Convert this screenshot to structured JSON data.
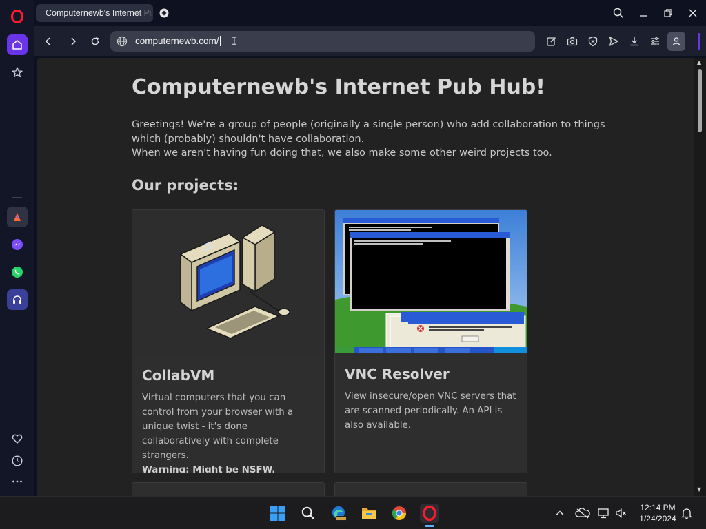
{
  "browser": {
    "tab_title": "Computernewb's Internet Pub Hub",
    "url": "computernewb.com/",
    "accent": "#6a35e8"
  },
  "sidebar": {
    "items": [
      {
        "name": "home",
        "icon": "home-icon"
      },
      {
        "name": "speed-dial",
        "icon": "star-icon"
      },
      {
        "name": "aria",
        "icon": "aria-icon"
      },
      {
        "name": "messenger",
        "icon": "messenger-icon"
      },
      {
        "name": "whatsapp",
        "icon": "whatsapp-icon"
      },
      {
        "name": "player",
        "icon": "music-player-icon"
      },
      {
        "name": "pinboards",
        "icon": "heart-icon"
      },
      {
        "name": "history",
        "icon": "clock-icon"
      },
      {
        "name": "more",
        "icon": "ellipsis-icon"
      }
    ]
  },
  "page": {
    "title": "Computernewb's Internet Pub Hub!",
    "intro_line1": "Greetings! We're a group of people (originally a single person) who add collaboration to things which (probably) shouldn't have collaboration.",
    "intro_line2": "When we aren't having fun doing that, we also make some other weird projects too.",
    "projects_heading": "Our projects:",
    "cards": [
      {
        "title": "CollabVM",
        "description": "Virtual computers that you can control from your browser with a unique twist - it's done collaboratively with complete strangers.",
        "warning": "Warning: Might be NSFW."
      },
      {
        "title": "VNC Resolver",
        "description": "View insecure/open VNC servers that are scanned periodically. An API is also available."
      }
    ]
  },
  "taskbar": {
    "time": "12:14 PM",
    "date": "1/24/2024",
    "apps": [
      "start-icon",
      "search-icon",
      "edge-dev-icon",
      "file-explorer-icon",
      "chrome-icon",
      "opera-icon"
    ]
  }
}
